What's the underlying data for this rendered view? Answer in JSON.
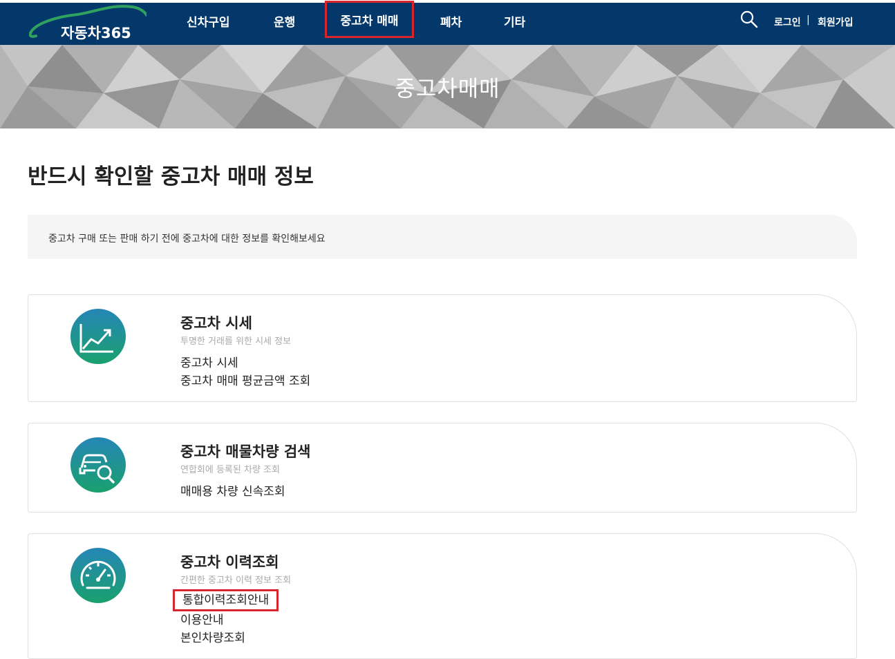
{
  "brand": {
    "name": "자동차365",
    "accent": "#04386a",
    "highlight": "#d8262c",
    "icon_gradient": [
      "#2586b5",
      "#1aa06e"
    ]
  },
  "nav": {
    "items": [
      "신차구입",
      "운행",
      "중고차 매매",
      "폐차",
      "기타"
    ],
    "active": "중고차 매매",
    "search_icon": "search-icon",
    "login": "로그인",
    "separator": "|",
    "signup": "회원가입"
  },
  "banner": {
    "title": "중고차매매"
  },
  "page": {
    "title": "반드시 확인할 중고차 매매 정보",
    "notice": "중고차 구매 또는 판매 하기 전에 중고차에 대한 정보를 확인해보세요"
  },
  "cards": [
    {
      "icon": "trend-chart-icon",
      "title": "중고차 시세",
      "subtitle": "투명한 거래를 위한 시세 정보",
      "links": [
        "중고차 시세",
        "중고차 매매 평균금액 조회"
      ]
    },
    {
      "icon": "car-search-icon",
      "title": "중고차 매물차량 검색",
      "subtitle": "연합회에 등록된 차량 조회",
      "links": [
        "매매용 차량 신속조회"
      ]
    },
    {
      "icon": "speedometer-icon",
      "title": "중고차 이력조회",
      "subtitle": "간편한 중고차 이력 정보 조회",
      "links": [
        "통합이력조회안내",
        "이용안내",
        "본인차량조회"
      ],
      "highlighted_link": "통합이력조회안내"
    }
  ]
}
